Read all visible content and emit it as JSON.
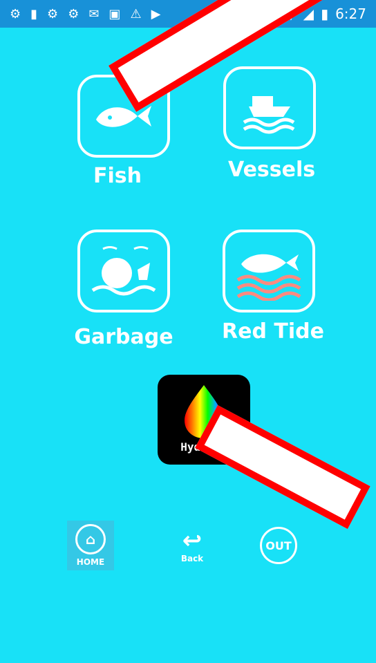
{
  "statusbar": {
    "time": "6:27",
    "icons": [
      "notification-icon",
      "notification-icon",
      "notification-icon",
      "notification-icon",
      "notification-icon",
      "image-icon",
      "alert-icon",
      "media-icon"
    ],
    "right_icons": [
      "wifi-icon",
      "signal-icon",
      "battery-icon"
    ]
  },
  "apps": [
    {
      "label": "Fish",
      "icon": "fish-icon"
    },
    {
      "label": "Vessels",
      "icon": "vessel-icon"
    },
    {
      "label": "Garbage",
      "icon": "garbage-icon"
    },
    {
      "label": "Red Tide",
      "icon": "red-tide-icon"
    }
  ],
  "hydro": {
    "label": "Hydro-C"
  },
  "nav": {
    "home": "HOME",
    "back": "Back",
    "out": "OUT"
  },
  "colors": {
    "background": "#18e1f7",
    "statusbar": "#1891d8",
    "annotation": "#ff0000"
  }
}
